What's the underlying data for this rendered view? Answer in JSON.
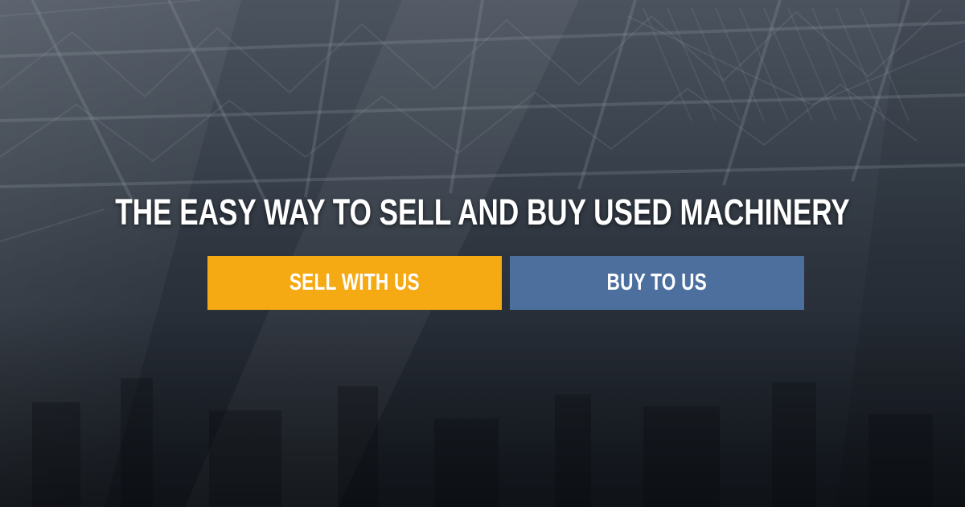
{
  "hero": {
    "headline": "THE EASY WAY TO SELL AND BUY USED MACHINERY",
    "sell_button": "SELL WITH US",
    "buy_button": "BUY TO US"
  },
  "colors": {
    "sell_button_bg": "#f5a913",
    "buy_button_bg": "#4d6f9e",
    "background_top": "#4b535f",
    "background_bottom": "#1b212a",
    "text": "#ffffff"
  }
}
